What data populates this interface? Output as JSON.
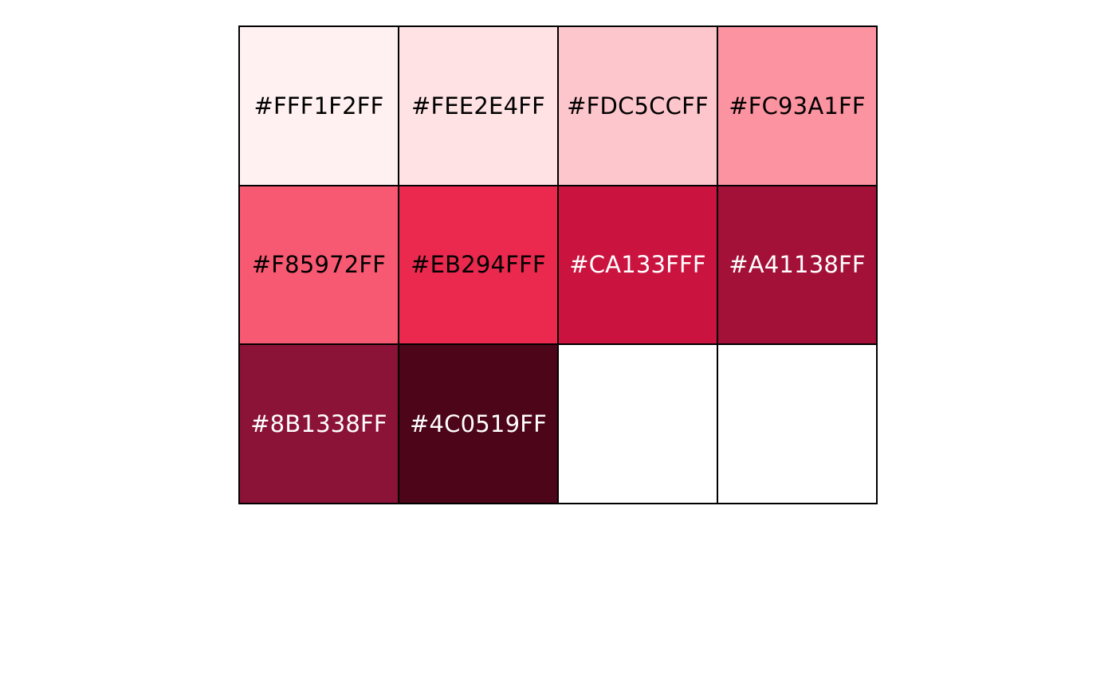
{
  "palette": {
    "swatches": [
      {
        "label": "#FFF1F2FF",
        "fill": "#FFF1F2",
        "text_color": "#000000"
      },
      {
        "label": "#FEE2E4FF",
        "fill": "#FEE2E4",
        "text_color": "#000000"
      },
      {
        "label": "#FDC5CCFF",
        "fill": "#FDC5CC",
        "text_color": "#000000"
      },
      {
        "label": "#FC93A1FF",
        "fill": "#FC93A1",
        "text_color": "#000000"
      },
      {
        "label": "#F85972FF",
        "fill": "#F85972",
        "text_color": "#000000"
      },
      {
        "label": "#EB294FFF",
        "fill": "#EB294F",
        "text_color": "#000000"
      },
      {
        "label": "#CA133FFF",
        "fill": "#CA133F",
        "text_color": "#FFFFFF"
      },
      {
        "label": "#A41138FF",
        "fill": "#A41138",
        "text_color": "#FFFFFF"
      },
      {
        "label": "#8B1338FF",
        "fill": "#8B1338",
        "text_color": "#FFFFFF"
      },
      {
        "label": "#4C0519FF",
        "fill": "#4C0519",
        "text_color": "#FFFFFF"
      },
      {
        "label": "",
        "fill": "#FFFFFF",
        "text_color": "#000000"
      },
      {
        "label": "",
        "fill": "#FFFFFF",
        "text_color": "#000000"
      }
    ]
  }
}
